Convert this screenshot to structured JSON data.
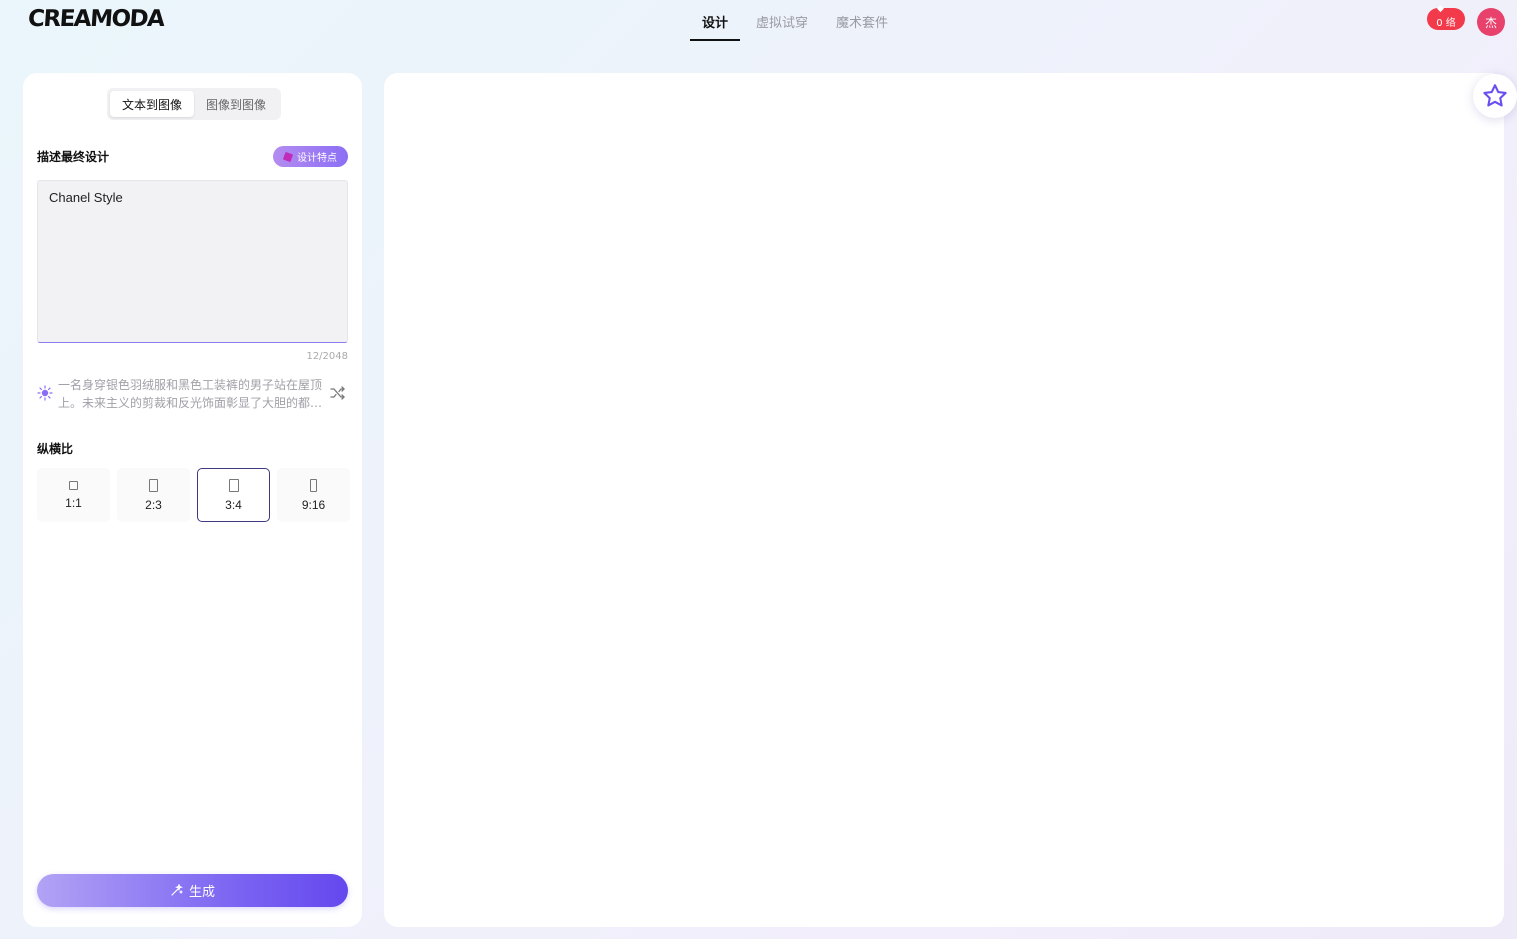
{
  "brand": {
    "logo": "CREAMODA"
  },
  "nav": {
    "items": [
      {
        "label": "设计",
        "active": true
      },
      {
        "label": "虚拟试穿",
        "active": false
      },
      {
        "label": "魔术套件",
        "active": false
      }
    ]
  },
  "header": {
    "credits": "0 络",
    "avatar_initial": "杰",
    "credits_color": "#f23a4a",
    "avatar_color": "#e8416b"
  },
  "left_panel": {
    "tabs": [
      {
        "label": "文本到图像",
        "active": true
      },
      {
        "label": "图像到图像",
        "active": false
      }
    ],
    "prompt_label": "描述最终设计",
    "feature_button": "设计特点",
    "prompt_value": "Chanel Style",
    "char_counter": "12/2048",
    "suggestion": "一名身穿银色羽绒服和黑色工装裤的男子站在屋顶上。未来主义的剪裁和反光饰面彰显了大胆的都市风格。",
    "aspect_label": "纵横比",
    "ratios": [
      {
        "label": "1:1",
        "selected": false
      },
      {
        "label": "2:3",
        "selected": false
      },
      {
        "label": "3:4",
        "selected": true
      },
      {
        "label": "9:16",
        "selected": false
      }
    ],
    "generate_label": "生成"
  },
  "icons": {
    "bulb": "lightbulb-icon",
    "shuffle": "shuffle-icon",
    "sparkle": "sparkle-icon",
    "star": "star-icon",
    "cube": "cube-icon"
  },
  "colors": {
    "accent": "#6a4ff0",
    "accent_light": "#b2a3f5"
  }
}
